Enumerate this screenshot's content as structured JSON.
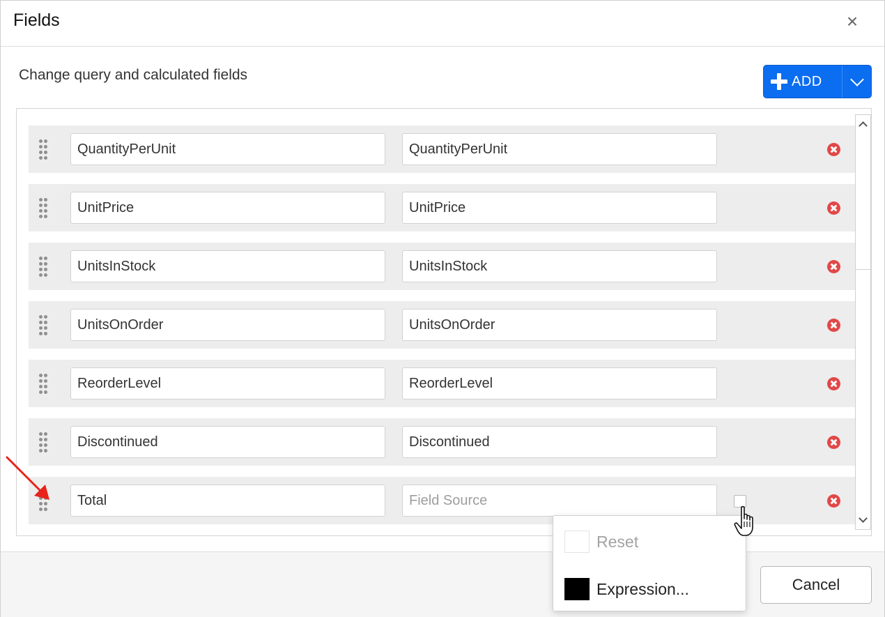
{
  "dialog": {
    "title": "Fields",
    "close_glyph": "×",
    "subtitle": "Change query and calculated fields"
  },
  "add_button": {
    "label": "ADD",
    "icon": "plus-icon",
    "dropdown_icon": "chevron-down-icon",
    "color": "#0b6df0"
  },
  "fields": [
    {
      "name": "QuantityPerUnit",
      "source": "QuantityPerUnit",
      "source_placeholder": ""
    },
    {
      "name": "UnitPrice",
      "source": "UnitPrice",
      "source_placeholder": ""
    },
    {
      "name": "UnitsInStock",
      "source": "UnitsInStock",
      "source_placeholder": ""
    },
    {
      "name": "UnitsOnOrder",
      "source": "UnitsOnOrder",
      "source_placeholder": ""
    },
    {
      "name": "ReorderLevel",
      "source": "ReorderLevel",
      "source_placeholder": ""
    },
    {
      "name": "Discontinued",
      "source": "Discontinued",
      "source_placeholder": ""
    },
    {
      "name": "Total",
      "source": "",
      "source_placeholder": "Field Source"
    }
  ],
  "context_menu": {
    "items": [
      {
        "label": "Reset",
        "enabled": false
      },
      {
        "label": "Expression...",
        "enabled": true
      }
    ]
  },
  "footer": {
    "cancel_label": "Cancel"
  },
  "colors": {
    "remove_icon": "#e24848",
    "annotation_arrow": "#e8231b"
  }
}
